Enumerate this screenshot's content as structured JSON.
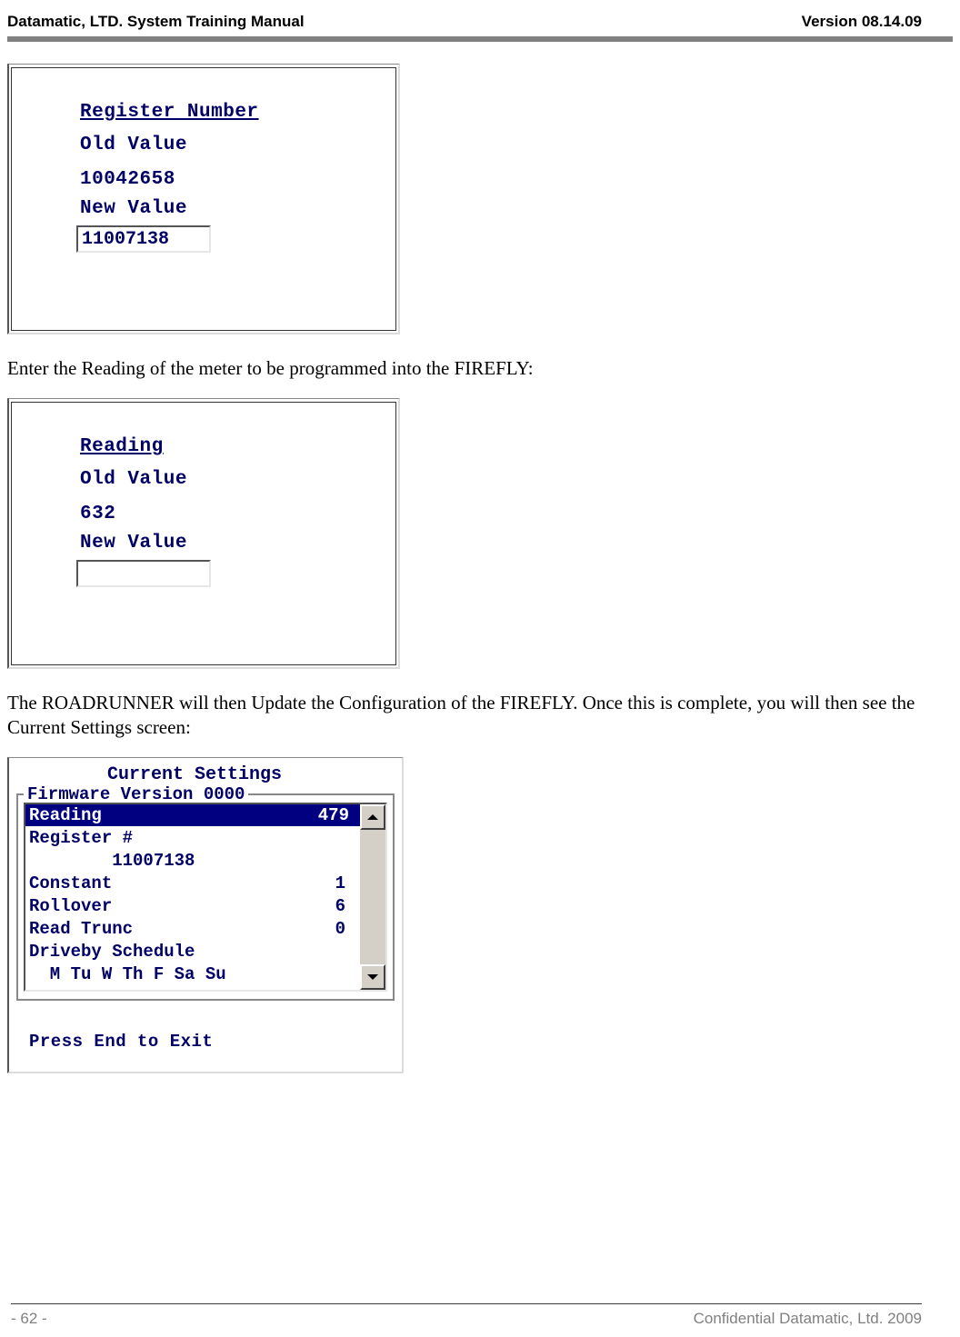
{
  "header": {
    "left": "Datamatic, LTD. System Training  Manual",
    "right": "Version 08.14.09"
  },
  "panel1": {
    "title": "Register Number",
    "old_label": "Old Value",
    "old_value": "10042658",
    "new_label": "New Value",
    "new_value": "11007138"
  },
  "para1": "Enter the Reading of the meter to be programmed into the FIREFLY:",
  "panel2": {
    "title": "Reading",
    "old_label": "Old Value",
    "old_value": "632",
    "new_label": "New Value",
    "new_value": ""
  },
  "para2": "The ROADRUNNER will then Update the Configuration of the FIREFLY. Once this is complete, you will then see the Current Settings screen:",
  "settings": {
    "title": "Current Settings",
    "firmware_legend": "Firmware Version 0000",
    "rows": [
      {
        "key": "Reading",
        "val": "479",
        "selected": true
      },
      {
        "key": "Register #",
        "val": ""
      },
      {
        "key": "        11007138",
        "val": ""
      },
      {
        "key": "Constant",
        "val": "1"
      },
      {
        "key": "Rollover",
        "val": "6"
      },
      {
        "key": "Read Trunc",
        "val": "0"
      },
      {
        "key": "Driveby Schedule",
        "val": ""
      },
      {
        "key": "  M Tu W Th F Sa Su",
        "val": ""
      }
    ],
    "exit_text": "Press End to Exit"
  },
  "footer": {
    "left": "- 62 -",
    "right": "Confidential Datamatic, Ltd. 2009"
  }
}
